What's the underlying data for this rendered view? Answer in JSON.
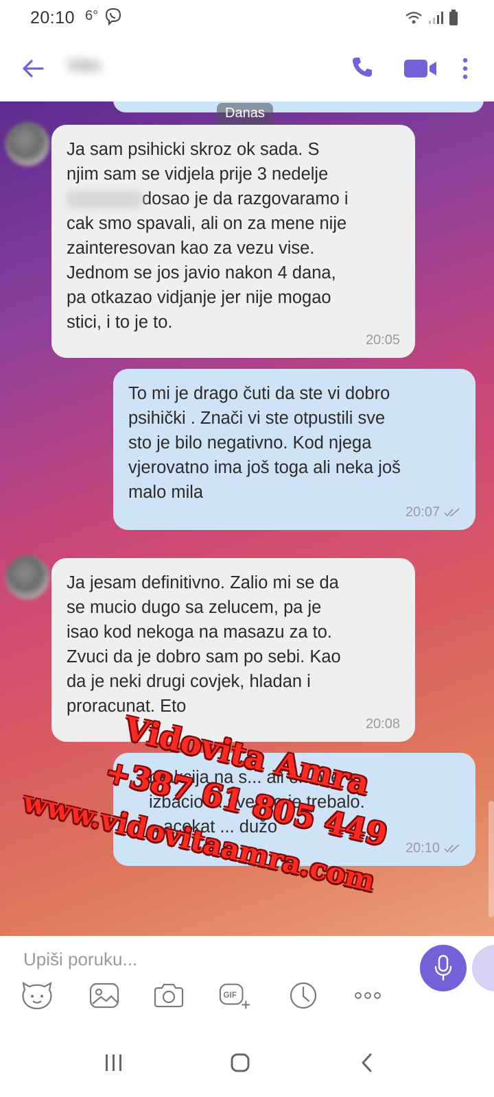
{
  "status_bar": {
    "time": "20:10",
    "temperature": "6°"
  },
  "header": {
    "contact_name": "Kiko"
  },
  "chat": {
    "date_chip": "Danas",
    "messages": [
      {
        "direction": "incoming",
        "lines": [
          "Ja sam psihicki skroz ok sada. S",
          "njim sam se vidjela prije 3 nedelje",
          "dosao je da razgovaramo i",
          "cak smo spavali, ali on za mene nije",
          "zainteresovan kao za vezu vise.",
          "Jednom se jos javio nakon 4 dana,",
          "pa otkazao vidjanje jer nije mogao",
          "stici, i to je to."
        ],
        "time": "20:05"
      },
      {
        "direction": "outgoing",
        "lines": [
          "To mi je drago čuti da ste vi dobro",
          "psihički . Znači vi ste otpustili sve",
          "sto je bilo negativno. Kod njega",
          "vjerovatno ima još toga ali neka još",
          "malo mila"
        ],
        "time": "20:07",
        "status": "read"
      },
      {
        "direction": "incoming",
        "lines": [
          "Ja jesam definitivno. Zalio mi se da",
          "se mucio dugo sa zelucem, pa je",
          "isao kod nekoga na masazu za to.",
          "Zvuci da je dobro sam po sebi. Kao",
          "da je neki drugi covjek, hladan i",
          "proracunat. Eto"
        ],
        "time": "20:08"
      },
      {
        "direction": "outgoing",
        "lines": [
          "reakcija na s... ali on nije",
          "izbacio ... sve sto je trebalo.",
          "...acekat ... dužo"
        ],
        "time": "20:10",
        "status": "read"
      }
    ]
  },
  "watermark": {
    "name": "Vidovita Amra",
    "phone": "+387 61 805 449",
    "website": "www.vidovitaamra.com"
  },
  "composer": {
    "placeholder": "Upiši poruku..."
  },
  "toolbar_icons": [
    "sticker-icon",
    "gallery-icon",
    "camera-icon",
    "gif-icon",
    "clock-icon",
    "more-dots-icon"
  ],
  "colors": {
    "accent": "#7460d8",
    "incoming_bubble": "#efefef",
    "outgoing_bubble": "#cfe3f7",
    "watermark": "#ff2a22"
  }
}
